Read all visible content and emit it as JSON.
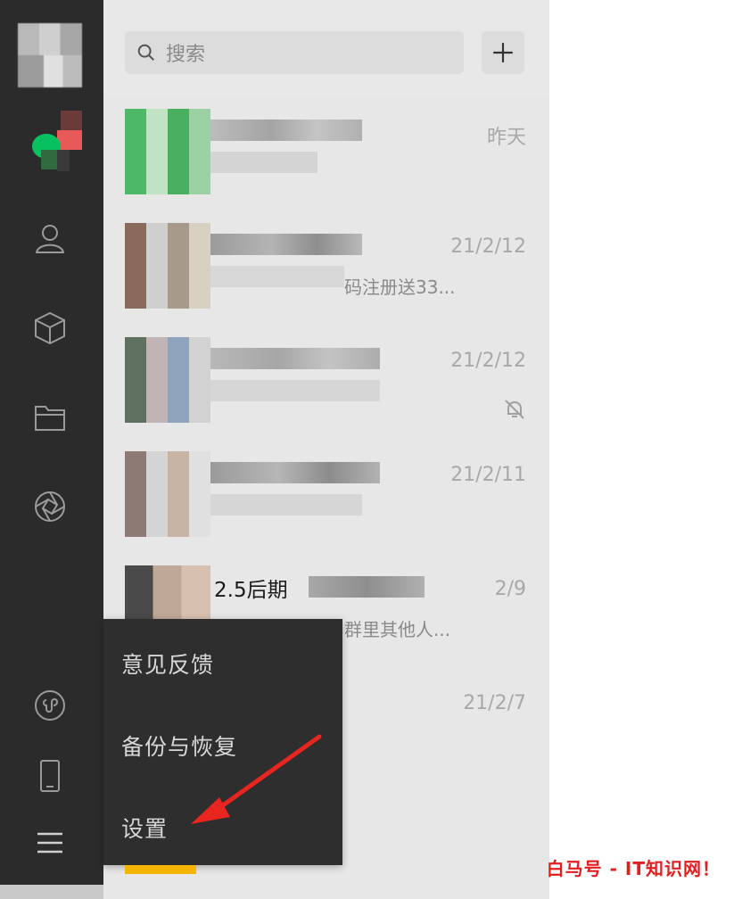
{
  "search": {
    "placeholder": "搜索"
  },
  "chats": [
    {
      "time": "昨天",
      "name": "",
      "preview": ""
    },
    {
      "time": "21/2/12",
      "name": "",
      "preview": "码注册送33..."
    },
    {
      "time": "21/2/12",
      "name": "",
      "preview": "",
      "muted": true
    },
    {
      "time": "21/2/11",
      "name": "",
      "preview": ""
    },
    {
      "time": "2/9",
      "name": "2.5后期",
      "preview": "群里其他人..."
    },
    {
      "time": "21/2/7",
      "name": "",
      "preview": ""
    }
  ],
  "menu": {
    "items": [
      "意见反馈",
      "备份与恢复",
      "设置"
    ]
  },
  "watermark": "白马号 - IT知识网！",
  "icons": {
    "sidebar": [
      "chat-icon",
      "contacts-icon",
      "cube-icon",
      "folder-icon",
      "moments-icon",
      "mini-program-icon",
      "phone-icon",
      "menu-icon"
    ]
  },
  "colors": {
    "sidebar_bg": "#2b2b2b",
    "panel_bg": "#e8e7e7",
    "accent_green": "#07c160",
    "arrow_red": "#e8261f",
    "watermark_red": "#e21e1e"
  }
}
